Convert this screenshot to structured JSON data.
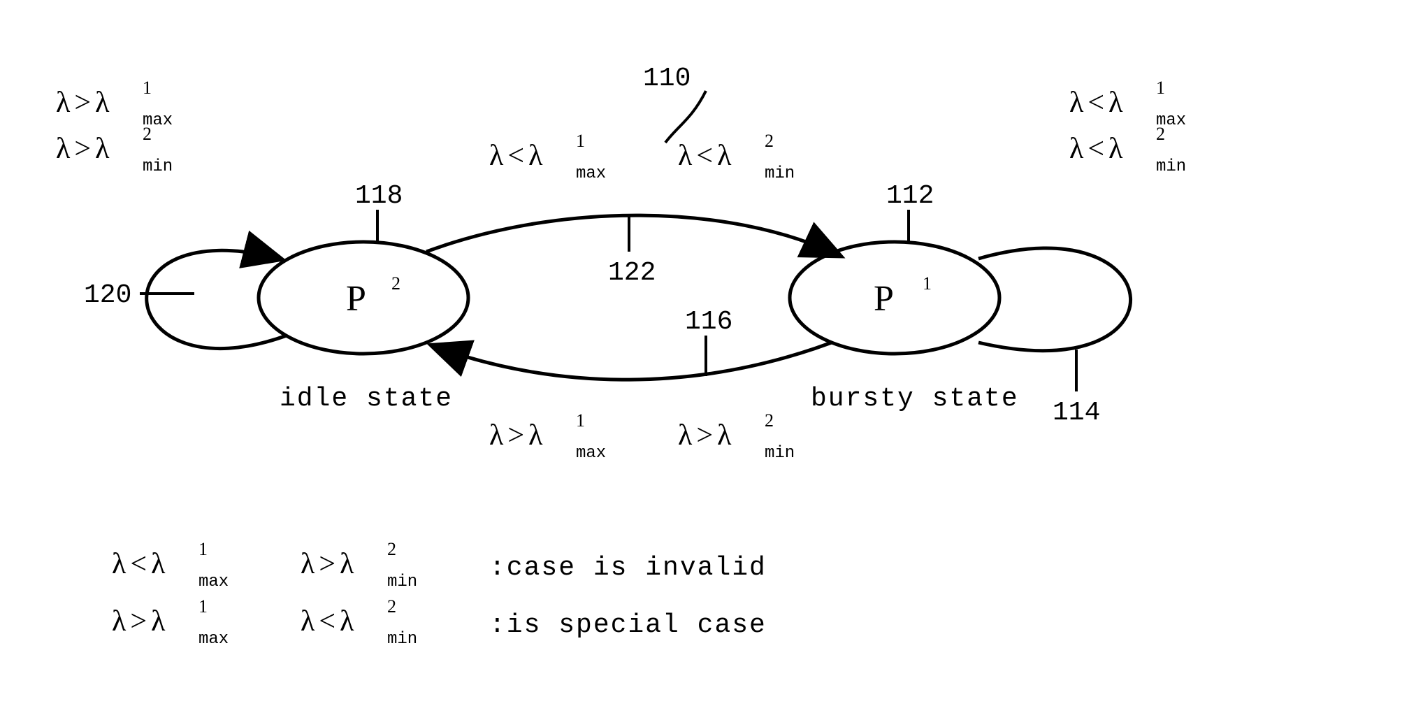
{
  "refs": {
    "r110": "110",
    "r112": "112",
    "r114": "114",
    "r116": "116",
    "r118": "118",
    "r120": "120",
    "r122": "122"
  },
  "states": {
    "p2": {
      "letter": "P",
      "sup": "2",
      "subtitle": "idle state"
    },
    "p1": {
      "letter": "P",
      "sup": "1",
      "subtitle": "bursty state"
    }
  },
  "conditions": {
    "selfLeft": {
      "line1": "λ > λ¹_max",
      "line2": "λ > λ²_min"
    },
    "selfRight": {
      "line1": "λ < λ¹_max",
      "line2": "λ < λ²_min"
    },
    "top": {
      "left": "λ < λ¹_max",
      "right": "λ < λ²_min"
    },
    "bottom": {
      "left": "λ > λ¹_max",
      "right": "λ > λ²_min"
    }
  },
  "legend": {
    "row1": {
      "c1": "λ < λ¹_max",
      "c2": "λ > λ²_min",
      "desc": ":case is invalid"
    },
    "row2": {
      "c1": "λ > λ¹_max",
      "c2": "λ < λ²_min",
      "desc": ":is special case"
    }
  },
  "symbols": {
    "lambda": "λ",
    "lt": "<",
    "gt": ">",
    "max": "max",
    "min": "min"
  }
}
